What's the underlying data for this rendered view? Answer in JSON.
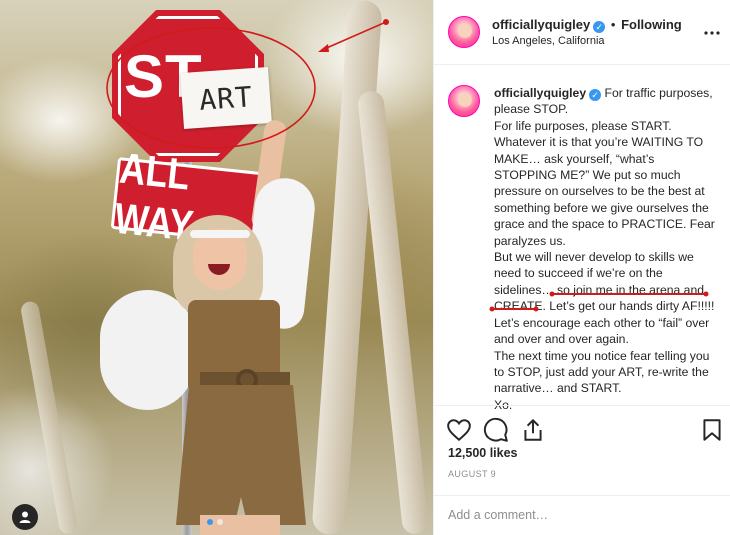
{
  "post": {
    "photo": {
      "stop_sign_text": "ST",
      "art_card_text": "ART",
      "all_way_text": "ALL WAY"
    },
    "header": {
      "username": "officiallyquigley",
      "separator": "•",
      "follow_status": "Following",
      "location": "Los Angeles, California",
      "more_icon": "more-horizontal-icon",
      "verified_icon": "✓"
    },
    "caption": {
      "username": "officiallyquigley",
      "text": "For traffic purposes, please STOP.\nFor life purposes, please START.\nWhatever it is that you’re WAITING TO MAKE… ask yourself, “what’s STOPPING ME?” We put so much pressure on ourselves to be the best at something before we give ourselves the grace and the space to PRACTICE. Fear paralyzes us.\nBut we will never develop to skills we need to succeed if we’re on the sidelines… so join me in the arena and CREATE. Let’s get our hands dirty AF!!!!! Let’s encourage each other to “fail” over and over and over again.\nThe next time you notice fear telling you to STOP, just add your ART, re-write the narrative… and START.\nXo."
    },
    "actions": {
      "like_icon": "heart-icon",
      "comment_icon": "comment-icon",
      "share_icon": "share-icon",
      "save_icon": "bookmark-icon"
    },
    "likes": "12,500 likes",
    "date": "AUGUST 9",
    "comment": {
      "placeholder": "Add a comment…",
      "value": ""
    },
    "colors": {
      "accent": "#3897f0",
      "annotation_red": "#d11a1a",
      "stop_red": "#cf1f2e"
    }
  }
}
